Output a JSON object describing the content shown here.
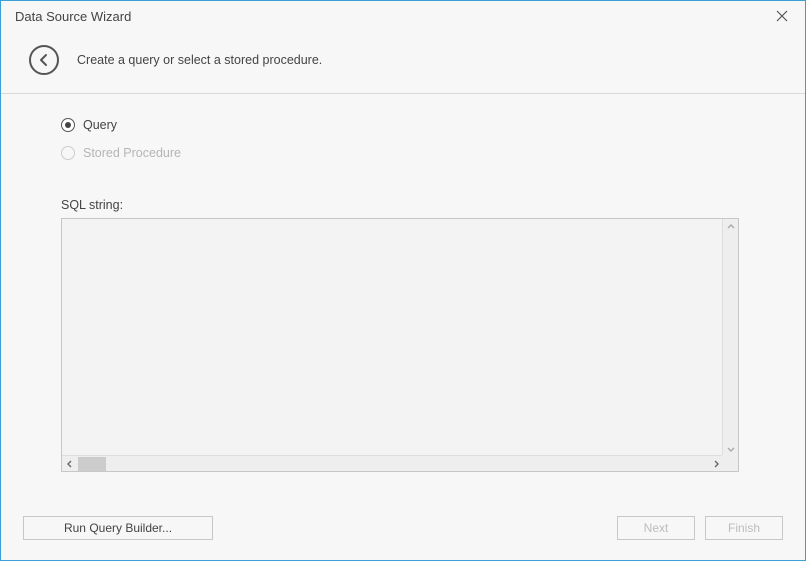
{
  "window": {
    "title": "Data Source Wizard"
  },
  "header": {
    "subtitle": "Create a query or select a stored procedure."
  },
  "options": {
    "query_label": "Query",
    "stored_proc_label": "Stored Procedure",
    "selected": "query"
  },
  "sql": {
    "label": "SQL string:",
    "value": ""
  },
  "buttons": {
    "run_query_builder": "Run Query Builder...",
    "next": "Next",
    "finish": "Finish"
  }
}
